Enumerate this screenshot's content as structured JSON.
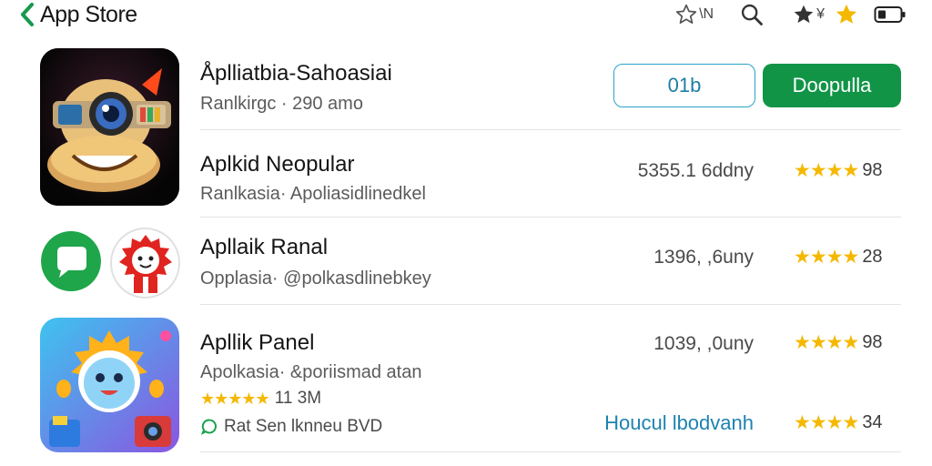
{
  "header": {
    "back_label": "App Store",
    "star_icon_text": "\\N",
    "dark_star_text": "¥"
  },
  "apps": [
    {
      "name": "Åplliatbia-Sahoasiai",
      "sub": "Ranlkirgc · 290 amo",
      "button_outline": "01b",
      "button_primary": "Doopulla"
    },
    {
      "name": "Aplkid Neopular",
      "sub": "Ranlkasia· Apoliasidlinedkel",
      "meta": "5355.1 6ddny",
      "stars": "★★★★",
      "rating": "98"
    },
    {
      "name": "Apllaik Ranal",
      "sub": "Opplasia· @polkasdlinebkey",
      "meta": "1396, ,6uny",
      "stars": "★★★★",
      "rating": "28"
    },
    {
      "name": "Apllik Panel",
      "sub": "Apolkasia· &poriismad atan",
      "meta": "1039, ,0uny",
      "stars": "★★★★",
      "rating": "98",
      "mini_stars": "★★★★★",
      "mini_count": "11 3M",
      "tagline": "Rat Sen lknneu BVD",
      "link": "Houcul lbodvanh",
      "link_stars": "★★★★",
      "link_rating": "34"
    }
  ],
  "colors": {
    "accent_green": "#129447",
    "accent_teal": "#1e82b0",
    "star_gold": "#f5b800"
  }
}
